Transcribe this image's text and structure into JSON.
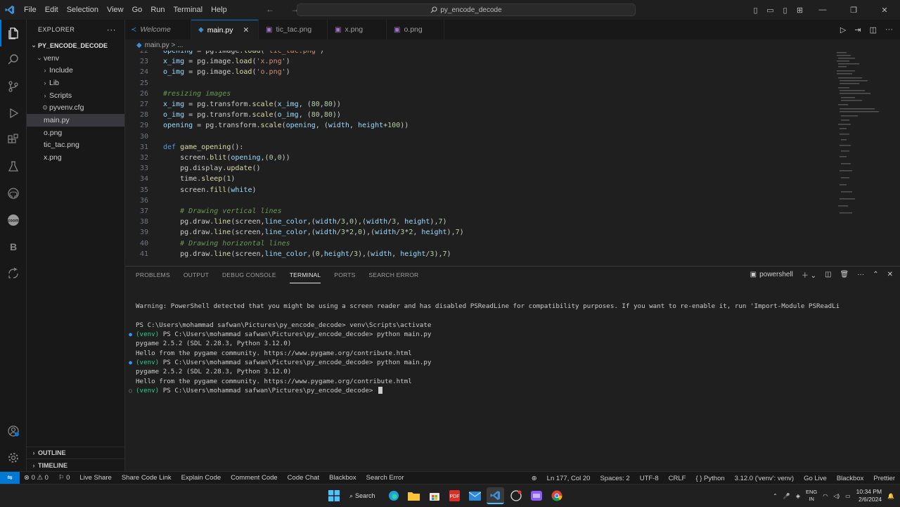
{
  "menu": [
    "File",
    "Edit",
    "Selection",
    "View",
    "Go",
    "Run",
    "Terminal",
    "Help"
  ],
  "command_center": "py_encode_decode",
  "explorer": {
    "title": "EXPLORER",
    "project": "PY_ENCODE_DECODE",
    "items": [
      {
        "label": "venv",
        "kind": "folder-open",
        "depth": 1
      },
      {
        "label": "Include",
        "kind": "folder",
        "depth": 2
      },
      {
        "label": "Lib",
        "kind": "folder",
        "depth": 2
      },
      {
        "label": "Scripts",
        "kind": "folder",
        "depth": 2
      },
      {
        "label": "pyvenv.cfg",
        "kind": "gear",
        "depth": 2
      },
      {
        "label": "main.py",
        "kind": "python",
        "depth": 1,
        "selected": true
      },
      {
        "label": "o.png",
        "kind": "image",
        "depth": 1
      },
      {
        "label": "tic_tac.png",
        "kind": "image",
        "depth": 1
      },
      {
        "label": "x.png",
        "kind": "image",
        "depth": 1
      }
    ],
    "outline": "OUTLINE",
    "timeline": "TIMELINE"
  },
  "tabs": [
    {
      "label": "Welcome",
      "icon": "vscode",
      "active": false,
      "italic": true
    },
    {
      "label": "main.py",
      "icon": "python",
      "active": true
    },
    {
      "label": "tic_tac.png",
      "icon": "image",
      "active": false
    },
    {
      "label": "x.png",
      "icon": "image",
      "active": false
    },
    {
      "label": "o.png",
      "icon": "image",
      "active": false
    }
  ],
  "breadcrumb": "main.py > ...",
  "code_lines": [
    {
      "n": "22",
      "html": "<span class='var'>opening</span> = pg.image.<span class='fn'>load</span>(<span class='str'>'tic_tac.png'</span>)"
    },
    {
      "n": "23",
      "html": "<span class='var'>x_img</span> = pg.image.<span class='fn'>load</span>(<span class='str'>'x.png'</span>)"
    },
    {
      "n": "24",
      "html": "<span class='var'>o_img</span> = pg.image.<span class='fn'>load</span>(<span class='str'>'o.png'</span>)"
    },
    {
      "n": "25",
      "html": ""
    },
    {
      "n": "26",
      "html": "<span class='cm'>#resizing images</span>"
    },
    {
      "n": "27",
      "html": "<span class='var'>x_img</span> = pg.transform.<span class='fn'>scale</span>(<span class='var'>x_img</span>, (<span class='num'>80</span>,<span class='num'>80</span>))"
    },
    {
      "n": "28",
      "html": "<span class='var'>o_img</span> = pg.transform.<span class='fn'>scale</span>(<span class='var'>o_img</span>, (<span class='num'>80</span>,<span class='num'>80</span>))"
    },
    {
      "n": "29",
      "html": "<span class='var'>opening</span> = pg.transform.<span class='fn'>scale</span>(<span class='var'>opening</span>, (<span class='var'>width</span>, <span class='var'>height</span>+<span class='num'>100</span>))"
    },
    {
      "n": "30",
      "html": ""
    },
    {
      "n": "31",
      "html": "<span class='kw'>def</span> <span class='fn'>game_opening</span>():"
    },
    {
      "n": "32",
      "html": "    screen.<span class='fn'>blit</span>(<span class='var'>opening</span>,(<span class='num'>0</span>,<span class='num'>0</span>))"
    },
    {
      "n": "33",
      "html": "    pg.display.<span class='fn'>update</span>()"
    },
    {
      "n": "34",
      "html": "    time.<span class='fn'>sleep</span>(<span class='num'>1</span>)"
    },
    {
      "n": "35",
      "html": "    screen.<span class='fn'>fill</span>(<span class='var'>white</span>)"
    },
    {
      "n": "36",
      "html": ""
    },
    {
      "n": "37",
      "html": "    <span class='cm'># Drawing vertical lines</span>"
    },
    {
      "n": "38",
      "html": "    pg.draw.<span class='fn'>line</span>(screen,<span class='var'>line_color</span>,(<span class='var'>width</span>/<span class='num'>3</span>,<span class='num'>0</span>),(<span class='var'>width</span>/<span class='num'>3</span>, <span class='var'>height</span>),<span class='num'>7</span>)"
    },
    {
      "n": "39",
      "html": "    pg.draw.<span class='fn'>line</span>(screen,<span class='var'>line_color</span>,(<span class='var'>width</span>/<span class='num'>3</span>*<span class='num'>2</span>,<span class='num'>0</span>),(<span class='var'>width</span>/<span class='num'>3</span>*<span class='num'>2</span>, <span class='var'>height</span>),<span class='num'>7</span>)"
    },
    {
      "n": "40",
      "html": "    <span class='cm'># Drawing horizontal lines</span>"
    },
    {
      "n": "41",
      "html": "    pg.draw.<span class='fn'>line</span>(screen,<span class='var'>line_color</span>,(<span class='num'>0</span>,<span class='var'>height</span>/<span class='num'>3</span>),(<span class='var'>width</span>, <span class='var'>height</span>/<span class='num'>3</span>),<span class='num'>7</span>)"
    }
  ],
  "panel_tabs": [
    "PROBLEMS",
    "OUTPUT",
    "DEBUG CONSOLE",
    "TERMINAL",
    "PORTS",
    "SEARCH ERROR"
  ],
  "panel_active": "TERMINAL",
  "terminal_shell": "powershell",
  "terminal_lines": [
    {
      "dot": "",
      "venv": "",
      "text": "Warning: PowerShell detected that you might be using a screen reader and has disabled PSReadLine for compatibility purposes. If you want to re-enable it, run 'Import-Module PSReadLi"
    },
    {
      "dot": "",
      "venv": "",
      "text": ""
    },
    {
      "dot": "",
      "venv": "",
      "text": "PS C:\\Users\\mohammad safwan\\Pictures\\py_encode_decode> venv\\Scripts\\activate"
    },
    {
      "dot": "blue",
      "venv": "(venv) ",
      "text": "PS C:\\Users\\mohammad safwan\\Pictures\\py_encode_decode> python main.py"
    },
    {
      "dot": "",
      "venv": "",
      "text": "pygame 2.5.2 (SDL 2.28.3, Python 3.12.0)"
    },
    {
      "dot": "",
      "venv": "",
      "text": "Hello from the pygame community. https://www.pygame.org/contribute.html"
    },
    {
      "dot": "blue",
      "venv": "(venv) ",
      "text": "PS C:\\Users\\mohammad safwan\\Pictures\\py_encode_decode> python main.py"
    },
    {
      "dot": "",
      "venv": "",
      "text": "pygame 2.5.2 (SDL 2.28.3, Python 3.12.0)"
    },
    {
      "dot": "",
      "venv": "",
      "text": "Hello from the pygame community. https://www.pygame.org/contribute.html"
    },
    {
      "dot": "hollow",
      "venv": "(venv) ",
      "text": "PS C:\\Users\\mohammad safwan\\Pictures\\py_encode_decode> ",
      "cursor": true
    }
  ],
  "status_left": [
    "⊗ 0 ⚠ 0",
    "⚐ 0",
    "Live Share",
    "Share Code Link",
    "Explain Code",
    "Comment Code",
    "Code Chat",
    "Blackbox",
    "Search Error"
  ],
  "status_right": [
    "Ln 177, Col 20",
    "Spaces: 2",
    "UTF-8",
    "CRLF",
    "{ } Python",
    "3.12.0 ('venv': venv)",
    "Go Live",
    "Blackbox",
    "Prettier"
  ],
  "taskbar": {
    "search": "Search",
    "lang_top": "ENG",
    "lang_bottom": "IN",
    "time": "10:34 PM",
    "date": "2/6/2024"
  },
  "colors": {
    "accent": "#0078d4",
    "editor_bg": "#1f1f1f",
    "sidebar_bg": "#181818"
  }
}
